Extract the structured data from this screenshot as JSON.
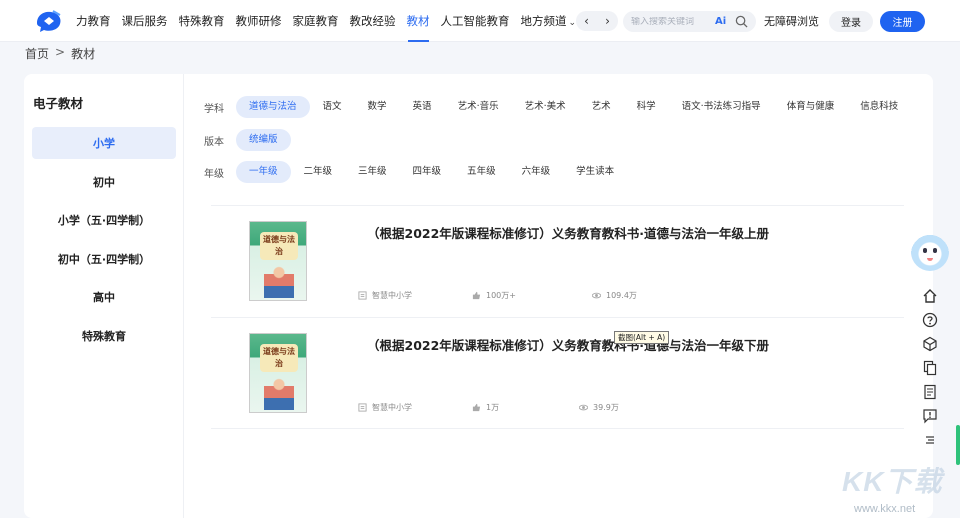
{
  "nav": {
    "items": [
      "力教育",
      "课后服务",
      "特殊教育",
      "教师研修",
      "家庭教育",
      "教改经验",
      "教材",
      "人工智能教育",
      "地方频道"
    ],
    "active_index": 6,
    "prev": "‹",
    "next": "›",
    "search_placeholder": "输入搜索关键词",
    "ai_label": "Ai",
    "accessible": "无障碍浏览",
    "login": "登录",
    "register": "注册"
  },
  "breadcrumb": {
    "home": "首页",
    "sep": ">",
    "current": "教材"
  },
  "sidebar": {
    "title": "电子教材",
    "items": [
      "小学",
      "初中",
      "小学（五·四学制）",
      "初中（五·四学制）",
      "高中",
      "特殊教育"
    ],
    "active_index": 0
  },
  "filters": {
    "subject": {
      "label": "学科",
      "options": [
        "道德与法治",
        "语文",
        "数学",
        "英语",
        "艺术·音乐",
        "艺术·美术",
        "艺术",
        "科学",
        "语文·书法练习指导",
        "体育与健康",
        "信息科技"
      ],
      "active_index": 0
    },
    "edition": {
      "label": "版本",
      "options": [
        "统编版"
      ],
      "active_index": 0
    },
    "grade": {
      "label": "年级",
      "options": [
        "一年级",
        "二年级",
        "三年级",
        "四年级",
        "五年级",
        "六年级",
        "学生读本"
      ],
      "active_index": 0
    }
  },
  "books": [
    {
      "title": "（根据2022年版课程标准修订）义务教育教科书·道德与法治一年级上册",
      "cover_text": "道德与法治",
      "publisher": "智慧中小学",
      "likes": "100万+",
      "views": "109.4万"
    },
    {
      "title": "（根据2022年版课程标准修订）义务教育教科书·道德与法治一年级下册",
      "cover_text": "道德与法治",
      "publisher": "智慧中小学",
      "likes": "1万",
      "views": "39.9万"
    }
  ],
  "tooltip": "截图(Alt + A)",
  "watermark": {
    "text": "KK下载",
    "url": "www.kkx.net"
  },
  "colors": {
    "accent": "#2d6cf0",
    "register": "#1f63f0",
    "active_bg": "#e8eefb",
    "scroll_accent": "#2ec27a"
  }
}
